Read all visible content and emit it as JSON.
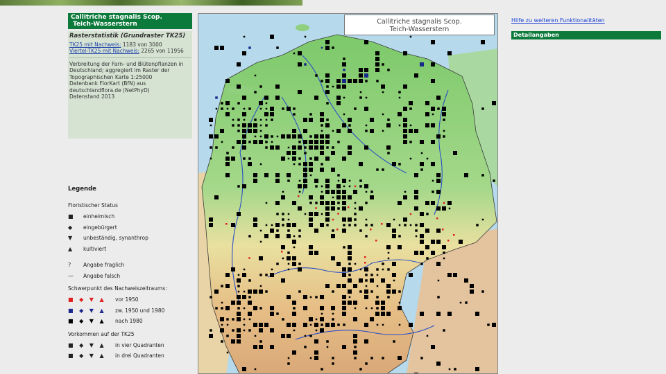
{
  "species": {
    "name": "Callitriche stagnalis Scop.",
    "common": "Teich-Wasserstern"
  },
  "stats": {
    "heading": "Rasterstatistik (Grundraster TK25)",
    "tk25_label": "TK25 mit Nachweis:",
    "tk25_value": " 1183 von 3000",
    "viertel_label": "Viertel-TK25 mit Nachweis:",
    "viertel_value": " 2265 von 11956",
    "description": "Verbreitung der Farn- und Blütenpflanzen in Deutschland; aggregiert im Raster der Topographischen Karte 1:25000",
    "source": "Datenbank FlorKart (BfN) aus deutschlandflora.de (NetPhyD)",
    "datenstand": "Datenstand 2013"
  },
  "legend": {
    "title": "Legende",
    "status_title": "Floristischer Status",
    "status_items": [
      {
        "symbol": "■",
        "label": "einheimisch"
      },
      {
        "symbol": "◆",
        "label": "eingebürgert"
      },
      {
        "symbol": "▼",
        "label": "unbeständig, synanthrop"
      },
      {
        "symbol": "▲",
        "label": "kultiviert"
      }
    ],
    "extra_items": [
      {
        "symbol": "?",
        "label": "Angabe fraglich"
      },
      {
        "symbol": "—",
        "label": "Angabe falsch"
      }
    ],
    "period_title": "Schwerpunkt des Nachweiszeitraums:",
    "period_items": [
      {
        "symbols": "■ ◆ ▼ ▲",
        "color": "#e02020",
        "label": "vor 1950"
      },
      {
        "symbols": "■ ◆ ▼ ▲",
        "color": "#1a2a8c",
        "label": "zw. 1950 und 1980"
      },
      {
        "symbols": "■ ◆ ▼ ▲",
        "color": "#000000",
        "label": "nach 1980"
      }
    ],
    "occurrence_title": "Vorkommen auf der TK25",
    "occurrence_items": [
      {
        "symbols": "■ ◆ ▼ ▲",
        "label": "in vier Quadranten"
      },
      {
        "symbols": "■ ◆ ▼ ▲",
        "label": "in drei Quadranten"
      }
    ]
  },
  "right": {
    "help_link": "Hilfe zu weiteren Funktionalitäten",
    "detail_label": "Detailangaben"
  },
  "colors": {
    "header_green": "#0b7a3b",
    "panel_green": "#d6e3d3",
    "record_before_1950": "#e02020",
    "record_1950_1980": "#1a2a8c",
    "record_after_1980": "#000000"
  }
}
